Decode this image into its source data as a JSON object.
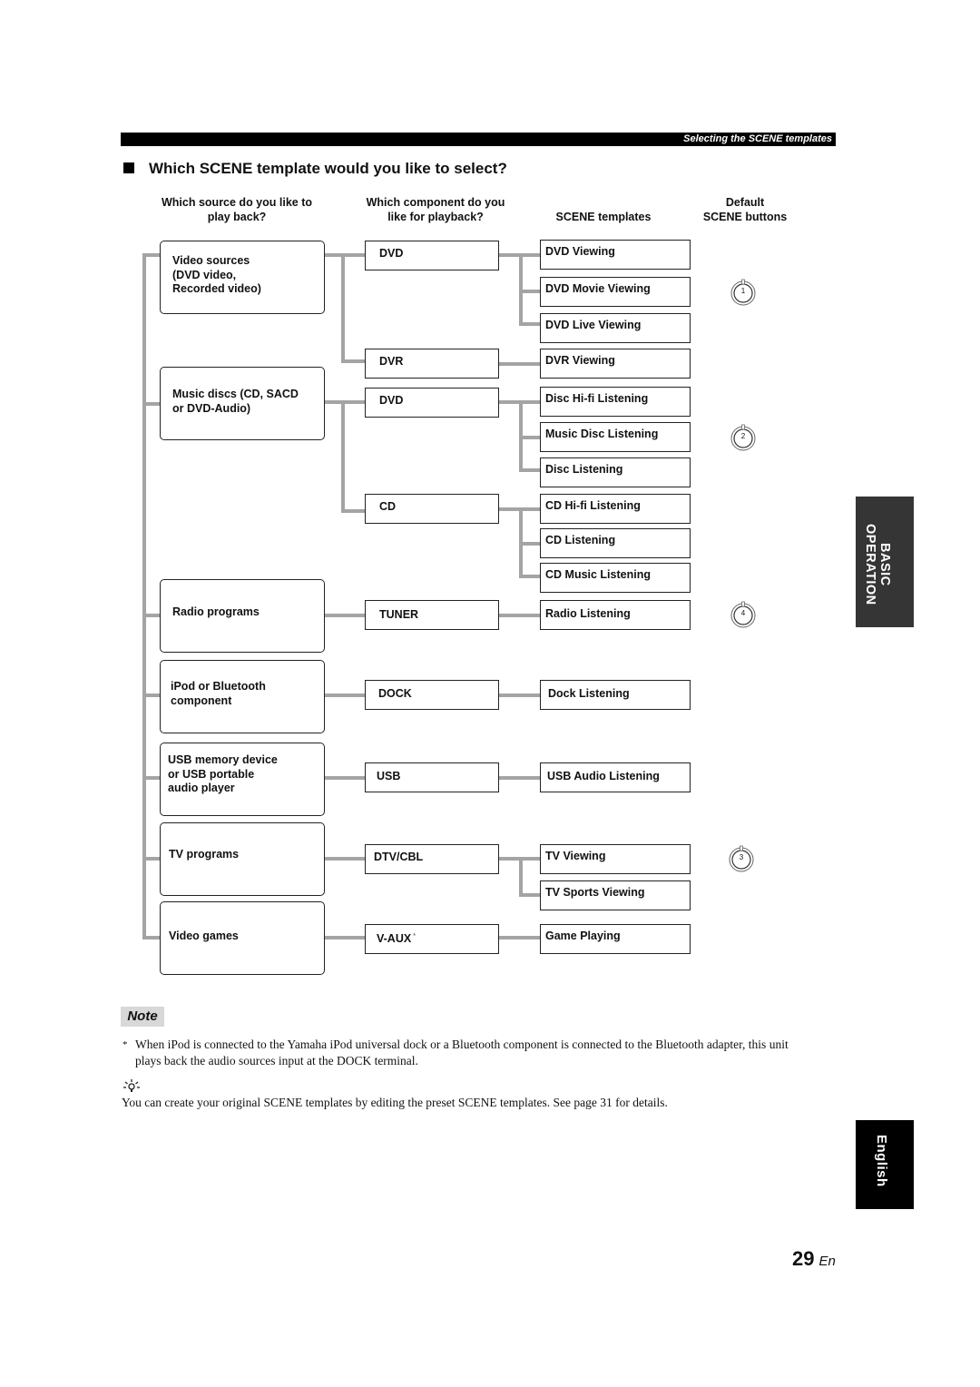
{
  "header": {
    "section": "Selecting the SCENE templates"
  },
  "title": "Which SCENE template would you like to select?",
  "columns": {
    "source_line1": "Which source do you like to",
    "source_line2": "play back?",
    "component_line1": "Which component do you",
    "component_line2": "like for playback?",
    "templates": "SCENE templates",
    "buttons_line1": "Default",
    "buttons_line2": "SCENE buttons"
  },
  "sources": [
    {
      "lines": [
        "Video sources",
        "(DVD video,",
        "Recorded video)"
      ]
    },
    {
      "lines": [
        "Music discs (CD, SACD",
        "or DVD-Audio)"
      ]
    },
    {
      "lines": [
        "Radio programs"
      ]
    },
    {
      "lines": [
        "iPod or Bluetooth",
        "component"
      ]
    },
    {
      "lines": [
        "USB memory device",
        "or USB portable",
        "audio player"
      ]
    },
    {
      "lines": [
        "TV programs"
      ]
    },
    {
      "lines": [
        "Video games"
      ]
    }
  ],
  "components": [
    {
      "label": "DVD"
    },
    {
      "label": "DVR"
    },
    {
      "label": "DVD"
    },
    {
      "label": "CD"
    },
    {
      "label": "TUNER"
    },
    {
      "label": "DOCK"
    },
    {
      "label": "USB"
    },
    {
      "label": "DTV/CBL"
    },
    {
      "label": "V-AUX",
      "mark": "*"
    }
  ],
  "templates": [
    "DVD Viewing",
    "DVD Movie Viewing",
    "DVD Live Viewing",
    "DVR Viewing",
    "Disc Hi-fi Listening",
    "Music Disc Listening",
    "Disc Listening",
    "CD Hi-fi Listening",
    "CD Listening",
    "CD Music Listening",
    "Radio Listening",
    "Dock Listening",
    "USB Audio Listening",
    "TV Viewing",
    "TV Sports Viewing",
    "Game Playing"
  ],
  "scene_buttons": [
    {
      "number": "1",
      "icon": "scene-knob-icon"
    },
    {
      "number": "2",
      "icon": "scene-knob-icon"
    },
    {
      "number": "4",
      "icon": "scene-knob-icon"
    },
    {
      "number": "3",
      "icon": "scene-knob-icon"
    }
  ],
  "side_tabs": {
    "basic": "BASIC",
    "operation": "OPERATION",
    "language": "English"
  },
  "note": {
    "label": "Note",
    "asterisk": "*",
    "text_line1": "When iPod is connected to the Yamaha iPod universal dock or a Bluetooth component is connected to the Bluetooth adapter, this unit",
    "text_line2": "plays back the audio sources input at the DOCK terminal.",
    "tip_icon": "lightbulb-tip-icon",
    "tip": "You can create your original SCENE templates by editing the preset SCENE templates. See page 31 for details."
  },
  "page": {
    "number": "29",
    "suffix": "En"
  }
}
